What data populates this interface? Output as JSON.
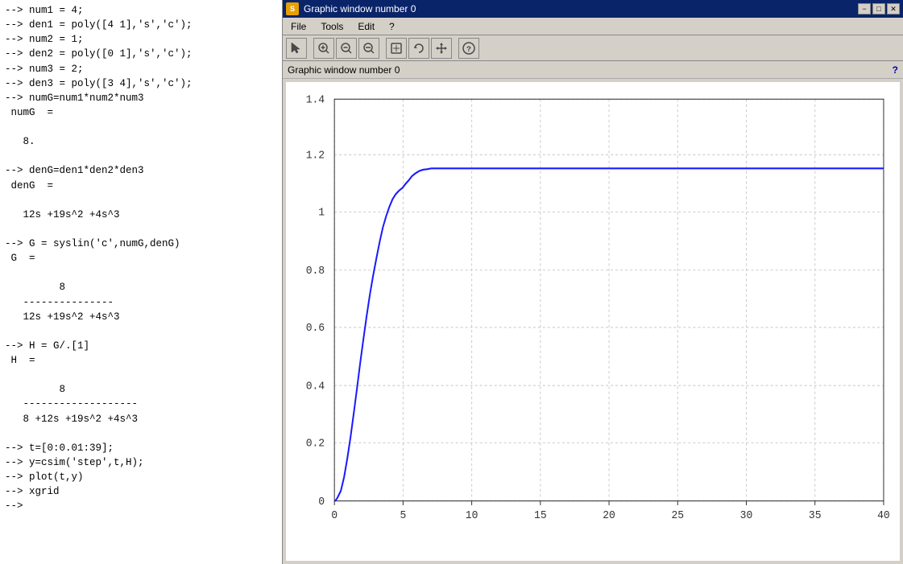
{
  "terminal": {
    "lines": [
      "--> num1 = 4;",
      "--> den1 = poly([4 1],'s','c');",
      "--> num2 = 1;",
      "--> den2 = poly([0 1],'s','c');",
      "--> num3 = 2;",
      "--> den3 = poly([3 4],'s','c');",
      "--> numG=num1*num2*num3",
      " numG  =",
      "",
      "   8.",
      "",
      "--> denG=den1*den2*den3",
      " denG  =",
      "",
      "   12s +19s^2 +4s^3",
      "",
      "--> G = syslin('c',numG,denG)",
      " G  =",
      "",
      "         8",
      "   ---------------",
      "   12s +19s^2 +4s^3",
      "",
      "--> H = G/.[1]",
      " H  =",
      "",
      "         8",
      "   -------------------",
      "   8 +12s +19s^2 +4s^3",
      "",
      "--> t=[0:0.01:39];",
      "--> y=csim('step',t,H);",
      "--> plot(t,y)",
      "--> xgrid",
      "-->"
    ]
  },
  "window": {
    "title": "Graphic window number 0",
    "icon_label": "S",
    "controls": {
      "minimize": "−",
      "maximize": "□",
      "close": "✕"
    }
  },
  "menu": {
    "items": [
      "File",
      "Tools",
      "Edit",
      "?"
    ]
  },
  "toolbar": {
    "buttons": [
      {
        "name": "select-tool",
        "icon": "↖",
        "label": "Select"
      },
      {
        "name": "zoom-in-tool",
        "icon": "⊕",
        "label": "Zoom In"
      },
      {
        "name": "zoom-in2-tool",
        "icon": "🔍",
        "label": "Zoom"
      },
      {
        "name": "zoom-out-tool",
        "icon": "🔎",
        "label": "Zoom Out"
      },
      {
        "name": "pan-tool",
        "icon": "⬜",
        "label": "Pan"
      },
      {
        "name": "rotate-tool",
        "icon": "↻",
        "label": "Rotate"
      },
      {
        "name": "move-tool",
        "icon": "✛",
        "label": "Move"
      },
      {
        "name": "help-tool",
        "icon": "?",
        "label": "Help"
      }
    ]
  },
  "status": {
    "label": "Graphic window number 0",
    "q_label": "?"
  },
  "chart": {
    "x_min": 0,
    "x_max": 40,
    "y_min": 0,
    "y_max": 1.4,
    "x_ticks": [
      0,
      5,
      10,
      15,
      20,
      25,
      30,
      35,
      40
    ],
    "y_ticks": [
      0,
      0.2,
      0.4,
      0.6,
      0.8,
      1.0,
      1.2,
      1.4
    ],
    "accent_color": "#1a1aff",
    "grid_color": "#cccccc"
  }
}
